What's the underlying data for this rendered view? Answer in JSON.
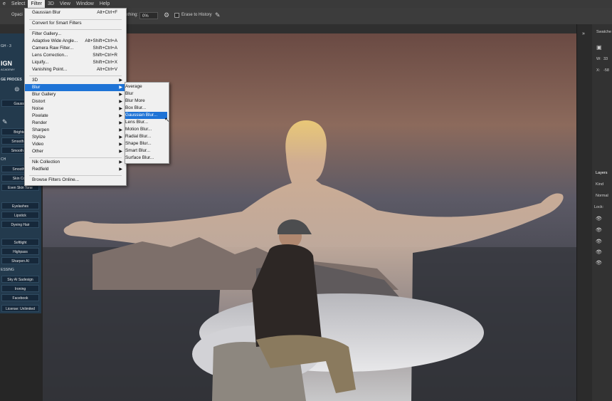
{
  "menubar": {
    "items": [
      "e",
      "Select",
      "Filter",
      "3D",
      "View",
      "Window",
      "Help"
    ],
    "active": "Filter"
  },
  "options_bar": {
    "opacity_label": "Opaci",
    "smoothing_label": "othing:",
    "smoothing_value": "0%",
    "erase_to_history": "Erase to History"
  },
  "filter_menu": {
    "items": [
      {
        "label": "Gaussian Blur",
        "shortcut": "Alt+Ctrl+F"
      },
      {
        "label": "Convert for Smart Filters"
      },
      {
        "label": "Filter Gallery..."
      },
      {
        "label": "Adaptive Wide Angle...",
        "shortcut": "Alt+Shift+Ctrl+A"
      },
      {
        "label": "Camera Raw Filter...",
        "shortcut": "Shift+Ctrl+A"
      },
      {
        "label": "Lens Correction...",
        "shortcut": "Shift+Ctrl+R"
      },
      {
        "label": "Liquify...",
        "shortcut": "Shift+Ctrl+X"
      },
      {
        "label": "Vanishing Point...",
        "shortcut": "Alt+Ctrl+V"
      },
      {
        "label": "3D",
        "submenu": true
      },
      {
        "label": "Blur",
        "submenu": true
      },
      {
        "label": "Blur Gallery",
        "submenu": true
      },
      {
        "label": "Distort",
        "submenu": true
      },
      {
        "label": "Noise",
        "submenu": true
      },
      {
        "label": "Pixelate",
        "submenu": true
      },
      {
        "label": "Render",
        "submenu": true
      },
      {
        "label": "Sharpen",
        "submenu": true
      },
      {
        "label": "Stylize",
        "submenu": true
      },
      {
        "label": "Video",
        "submenu": true
      },
      {
        "label": "Other",
        "submenu": true
      },
      {
        "label": "Nik Collection",
        "submenu": true
      },
      {
        "label": "Redfield",
        "submenu": true
      },
      {
        "label": "Browse Filters Online..."
      }
    ],
    "highlighted": "Blur"
  },
  "blur_submenu": {
    "items": [
      "Average",
      "Blur",
      "Blur More",
      "Box Blur...",
      "Gaussian Blur...",
      "Lens Blur...",
      "Motion Blur...",
      "Radial Blur...",
      "Shape Blur...",
      "Smart Blur...",
      "Surface Blur..."
    ],
    "highlighted": "Gaussian Blur..."
  },
  "left_panel": {
    "brand": "IGN",
    "brand_sub": "ACADEMY",
    "section_process": "GE PROCES",
    "gaussian": "Gaussia",
    "brighten": "Brighten",
    "smooth_sk1": "Smooth Sk",
    "smooth_sk2": "Smooth Ski",
    "ch": "CH",
    "smooth_c": "Smooth C",
    "skin_color": "Skin Colo",
    "even_skin_tone": "Even Skin Tone",
    "eyelashes": "Eyelashes",
    "lipstick": "Lipstick",
    "dyeing_hair": "Dyeing Hair",
    "softlight": "Softlight",
    "highpass": "Highpass",
    "sharpen_ai": "Sharpen AI",
    "section_essing": "ESSING",
    "sky_ai": "Sky AI Sadesign",
    "ironing": "Ironing",
    "facebook": "Facebook",
    "license": "License: Unlimited"
  },
  "right_panel": {
    "swatches": "Swatche",
    "w_label": "W:",
    "w_value": "33",
    "x_label": "X:",
    "x_value": "-58",
    "layers": "Layers",
    "kind": "Kind",
    "normal": "Normal",
    "lock": "Lock:"
  },
  "colors": {
    "menu_highlight": "#1e73d6",
    "panel_blue": "#233a4d"
  }
}
